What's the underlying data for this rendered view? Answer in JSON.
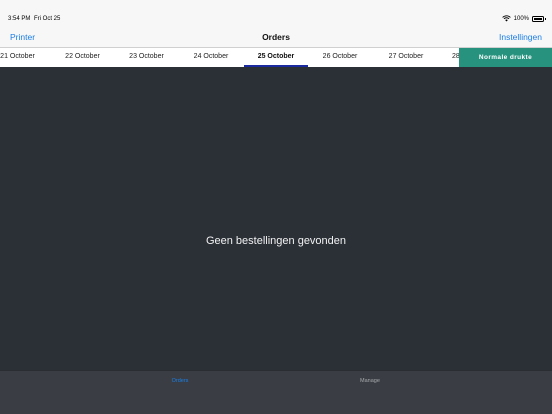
{
  "status_bar": {
    "time": "3:54 PM",
    "date": "Fri Oct 25",
    "battery": "100%",
    "icons": [
      "wifi-icon",
      "battery-icon"
    ]
  },
  "nav": {
    "left_label": "Printer",
    "title": "Orders",
    "right_label": "Instellingen",
    "accent_color": "#1a7ee6"
  },
  "dates": {
    "tabs": [
      {
        "label": "21 October"
      },
      {
        "label": "22 October"
      },
      {
        "label": "23 October"
      },
      {
        "label": "24 October"
      },
      {
        "label": "25 October",
        "selected": true
      },
      {
        "label": "26 October"
      },
      {
        "label": "27 October"
      },
      {
        "label": "28"
      }
    ],
    "busy_label": "Normale drukte",
    "busy_color": "#27937e"
  },
  "main": {
    "empty_message": "Geen bestellingen gevonden",
    "background": "#2b3037"
  },
  "tab_bar": {
    "orders_label": "Orders",
    "manage_label": "Manage"
  }
}
